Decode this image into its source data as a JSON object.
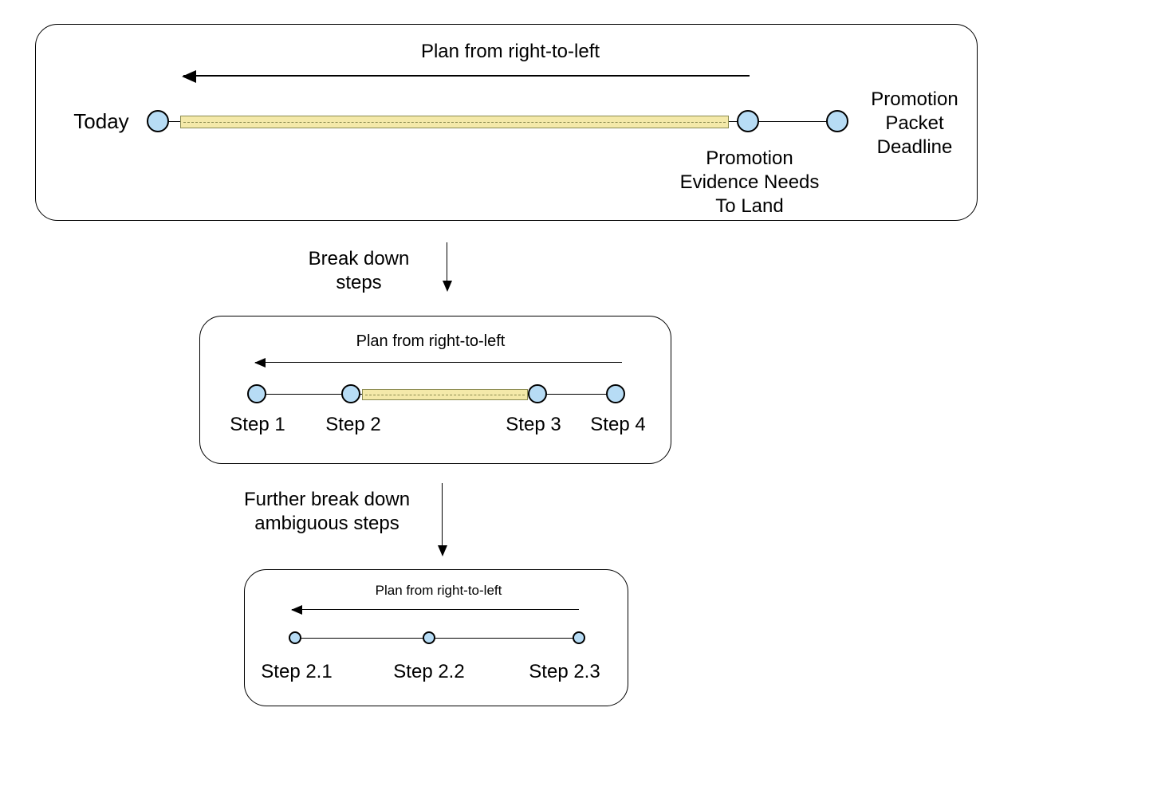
{
  "panel1": {
    "arrow_caption": "Plan from right-to-left",
    "left_label": "Today",
    "mid_label": "Promotion\nEvidence Needs\nTo Land",
    "right_label": "Promotion\nPacket\nDeadline"
  },
  "connector1": "Break down\nsteps",
  "panel2": {
    "arrow_caption": "Plan from right-to-left",
    "steps": [
      "Step 1",
      "Step 2",
      "Step 3",
      "Step 4"
    ]
  },
  "connector2": "Further break down\nambiguous steps",
  "panel3": {
    "arrow_caption": "Plan from right-to-left",
    "steps": [
      "Step 2.1",
      "Step 2.2",
      "Step 2.3"
    ]
  }
}
